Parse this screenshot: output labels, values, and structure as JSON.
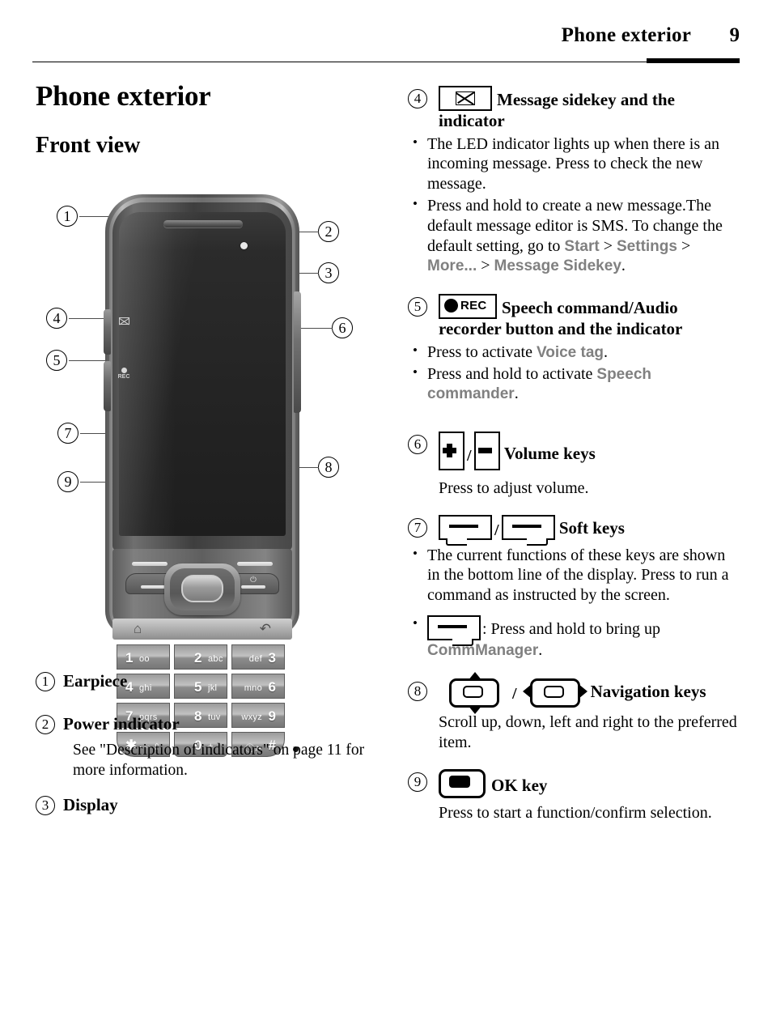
{
  "header": {
    "title": "Phone exterior",
    "page_number": "9"
  },
  "document": {
    "title": "Phone exterior",
    "subtitle": "Front view"
  },
  "left_items": [
    {
      "number": "1",
      "label": "Earpiece",
      "note": ""
    },
    {
      "number": "2",
      "label": "Power indicator",
      "note": "See \"Description of indicators\" on page 11 for more information."
    },
    {
      "number": "3",
      "label": "Display",
      "note": ""
    }
  ],
  "right_items": [
    {
      "number": "4",
      "icon": "message-envelope-icon",
      "heading": "Message sidekey and the indicator",
      "bullets": [
        "The LED indicator lights up when there is an incoming message. Press to check the new message.",
        "Press and hold to create a new message.The default message editor is SMS. To change the default setting, go to Start > Settings > More... > Message Sidekey."
      ],
      "ui_terms": [
        "Start",
        "Settings",
        "More...",
        "Message Sidekey"
      ]
    },
    {
      "number": "5",
      "icon": "record-rec-icon",
      "icon_label": "REC",
      "heading": "Speech command/Audio recorder button and the indicator",
      "bullets": [
        "Press to activate Voice tag.",
        "Press and hold to activate Speech commander."
      ],
      "ui_terms": [
        "Voice tag",
        "Speech commander"
      ]
    },
    {
      "number": "6",
      "icon": "volume-up-down-icon",
      "heading": "Volume keys",
      "body": "Press to adjust volume."
    },
    {
      "number": "7",
      "icon": "soft-keys-icon",
      "heading": "Soft keys",
      "bullets": [
        "The current functions of these keys are shown in the bottom line of the display. Press to run a command as instructed by the screen.",
        ": Press and hold to bring up CommManager."
      ],
      "ui_terms": [
        "CommManager"
      ]
    },
    {
      "number": "8",
      "icon": "navigation-keys-icon",
      "heading": "Navigation keys",
      "body": "Scroll up, down, left and right to the preferred item."
    },
    {
      "number": "9",
      "icon": "ok-key-icon",
      "heading": "OK key",
      "body": "Press to start a function/confirm selection."
    }
  ],
  "figure": {
    "callouts": [
      "1",
      "2",
      "3",
      "4",
      "5",
      "6",
      "7",
      "8",
      "9"
    ],
    "side_key_labels": {
      "message": "message-sidekey",
      "record": "REC"
    },
    "keypad": [
      {
        "num": "1",
        "letters": "oo",
        "align": "left"
      },
      {
        "num": "2",
        "letters": "abc",
        "align": "center"
      },
      {
        "num": "3",
        "letters": "def",
        "align": "right"
      },
      {
        "num": "4",
        "letters": "ghi",
        "align": "left"
      },
      {
        "num": "5",
        "letters": "jkl",
        "align": "center"
      },
      {
        "num": "6",
        "letters": "mno",
        "align": "right"
      },
      {
        "num": "7",
        "letters": "pqrs",
        "align": "left"
      },
      {
        "num": "8",
        "letters": "tuv",
        "align": "center"
      },
      {
        "num": "9",
        "letters": "wxyz",
        "align": "right"
      },
      {
        "num": "✱",
        "letters": "⊸◦ ⇧",
        "align": "left"
      },
      {
        "num": "0",
        "letters": "+",
        "align": "center"
      },
      {
        "num": "#",
        "letters": "ⓘ≋",
        "align": "right"
      }
    ],
    "nav_strip": {
      "home": "⌂",
      "back": "↶"
    },
    "power_glyph": "⏻"
  },
  "colors": {
    "text": "#000000",
    "ui_term": "#808080",
    "rule": "#000000"
  }
}
